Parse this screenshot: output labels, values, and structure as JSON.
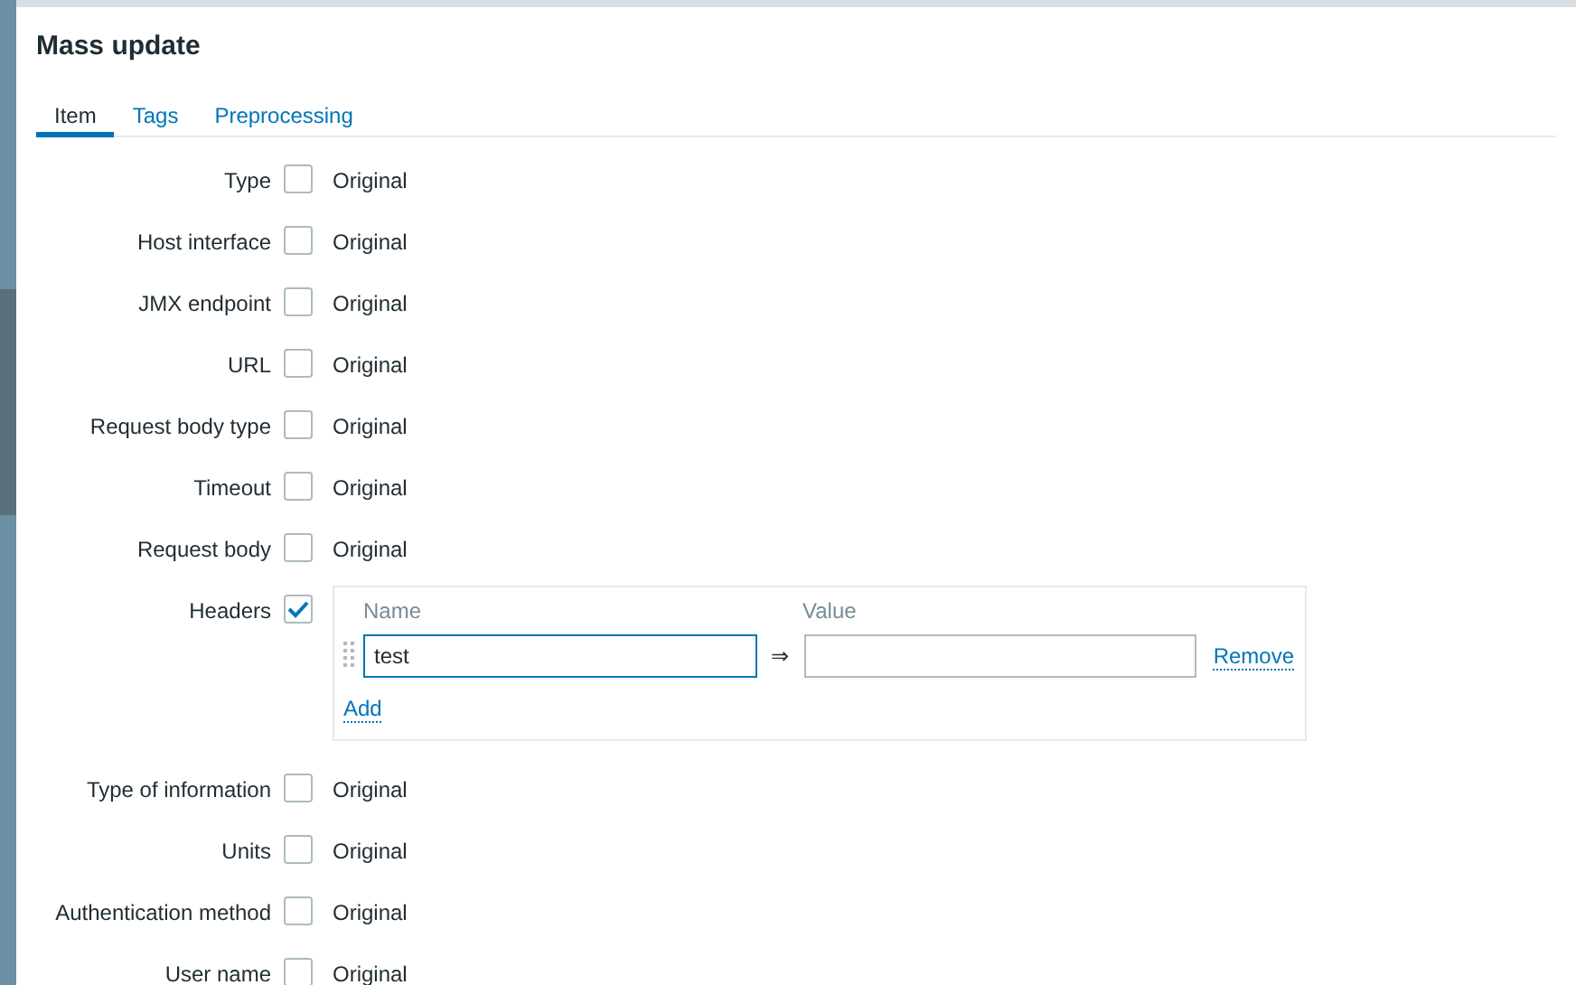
{
  "dialog": {
    "title": "Mass update"
  },
  "tabs": [
    {
      "label": "Item",
      "selected": true
    },
    {
      "label": "Tags",
      "selected": false
    },
    {
      "label": "Preprocessing",
      "selected": false
    }
  ],
  "fields": [
    {
      "kind": "checkbox",
      "label": "Type",
      "checked": false,
      "value": "Original"
    },
    {
      "kind": "checkbox",
      "label": "Host interface",
      "checked": false,
      "value": "Original"
    },
    {
      "kind": "checkbox",
      "label": "JMX endpoint",
      "checked": false,
      "value": "Original"
    },
    {
      "kind": "checkbox",
      "label": "URL",
      "checked": false,
      "value": "Original"
    },
    {
      "kind": "checkbox",
      "label": "Request body type",
      "checked": false,
      "value": "Original"
    },
    {
      "kind": "checkbox",
      "label": "Timeout",
      "checked": false,
      "value": "Original"
    },
    {
      "kind": "checkbox",
      "label": "Request body",
      "checked": false,
      "value": "Original"
    },
    {
      "kind": "headers",
      "label": "Headers",
      "checked": true,
      "columns": [
        "Name",
        "Value"
      ],
      "rows": [
        {
          "name": "test",
          "value": "",
          "arrow": "⇒",
          "remove": "Remove"
        }
      ],
      "add": "Add"
    },
    {
      "kind": "checkbox",
      "label": "Type of information",
      "checked": false,
      "value": "Original"
    },
    {
      "kind": "checkbox",
      "label": "Units",
      "checked": false,
      "value": "Original"
    },
    {
      "kind": "checkbox",
      "label": "Authentication method",
      "checked": false,
      "value": "Original"
    },
    {
      "kind": "checkbox",
      "label": "User name",
      "checked": false,
      "value": "Original"
    }
  ]
}
